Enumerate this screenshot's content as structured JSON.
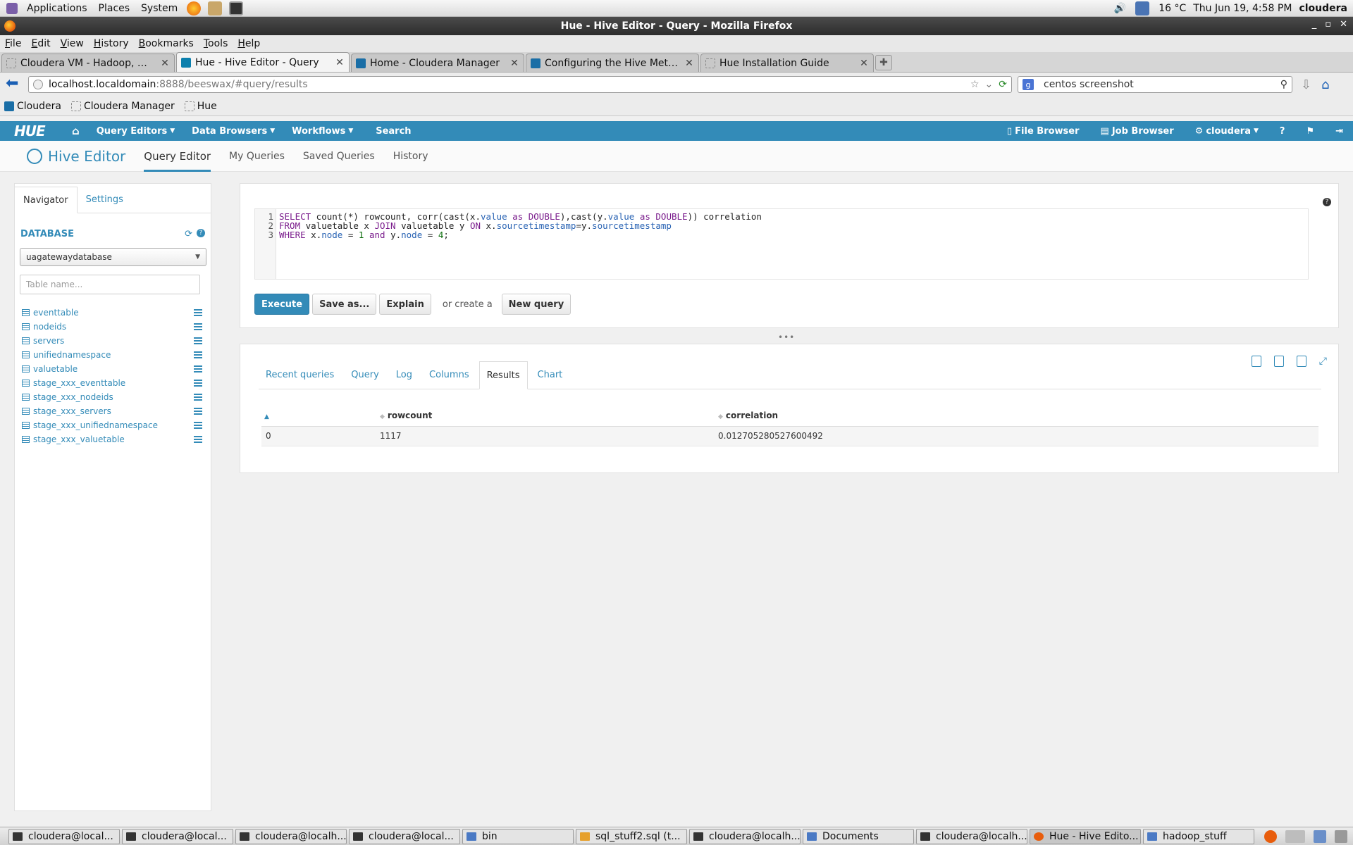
{
  "panel": {
    "menus": [
      "Applications",
      "Places",
      "System"
    ],
    "weather": "16 °C",
    "clock": "Thu Jun 19,  4:58 PM",
    "user": "cloudera"
  },
  "window": {
    "title": "Hue - Hive Editor - Query - Mozilla Firefox"
  },
  "menubar": [
    "File",
    "Edit",
    "View",
    "History",
    "Bookmarks",
    "Tools",
    "Help"
  ],
  "tabs": [
    {
      "title": "Cloudera VM - Hadoop, mad...",
      "active": false
    },
    {
      "title": "Hue - Hive Editor - Query",
      "active": true
    },
    {
      "title": "Home - Cloudera Manager",
      "active": false
    },
    {
      "title": "Configuring the Hive Metast...",
      "active": false
    },
    {
      "title": "Hue Installation Guide",
      "active": false
    }
  ],
  "url": {
    "host": "localhost.localdomain",
    "path": ":8888/beeswax/#query/results"
  },
  "search": {
    "value": "centos screenshot"
  },
  "bookmarks": [
    "Cloudera",
    "Cloudera Manager",
    "Hue"
  ],
  "hue_nav": {
    "logo": "HUE",
    "items": [
      "Query Editors",
      "Data Browsers",
      "Workflows",
      "Search"
    ],
    "right": [
      "File Browser",
      "Job Browser",
      "cloudera"
    ]
  },
  "subnav": {
    "brand": "Hive Editor",
    "items": [
      "Query Editor",
      "My Queries",
      "Saved Queries",
      "History"
    ]
  },
  "navigator": {
    "tabs": [
      "Navigator",
      "Settings"
    ],
    "db_label": "DATABASE",
    "db_selected": "uagatewaydatabase",
    "filter_placeholder": "Table name...",
    "tables": [
      "eventtable",
      "nodeids",
      "servers",
      "unifiednamespace",
      "valuetable",
      "stage_xxx_eventtable",
      "stage_xxx_nodeids",
      "stage_xxx_servers",
      "stage_xxx_unifiednamespace",
      "stage_xxx_valuetable"
    ]
  },
  "editor": {
    "line_numbers": [
      "1",
      "2",
      "3"
    ],
    "query_lines": [
      "SELECT count(*) rowcount, corr(cast(x.value as DOUBLE),cast(y.value as DOUBLE)) correlation",
      "FROM valuetable x JOIN valuetable y ON x.sourcetimestamp=y.sourcetimestamp",
      "WHERE x.node = 1 and y.node = 4;"
    ],
    "buttons": {
      "execute": "Execute",
      "save": "Save as...",
      "explain": "Explain",
      "or_create": "or create a",
      "new_query": "New query"
    }
  },
  "results": {
    "tabs": [
      "Recent queries",
      "Query",
      "Log",
      "Columns",
      "Results",
      "Chart"
    ],
    "active_tab": "Results",
    "columns": [
      "",
      "rowcount",
      "correlation"
    ],
    "rows": [
      [
        "0",
        "1117",
        "0.012705280527600492"
      ]
    ]
  },
  "taskbar": [
    {
      "label": "cloudera@local...",
      "icon": "terminal"
    },
    {
      "label": "cloudera@local...",
      "icon": "terminal"
    },
    {
      "label": "cloudera@localh...",
      "icon": "terminal"
    },
    {
      "label": "cloudera@local...",
      "icon": "terminal"
    },
    {
      "label": "bin",
      "icon": "folder"
    },
    {
      "label": "sql_stuff2.sql (t...",
      "icon": "document"
    },
    {
      "label": "cloudera@localh...",
      "icon": "terminal"
    },
    {
      "label": "Documents",
      "icon": "folder"
    },
    {
      "label": "cloudera@localh...",
      "icon": "terminal"
    },
    {
      "label": "Hue - Hive Edito...",
      "icon": "firefox"
    },
    {
      "label": "hadoop_stuff",
      "icon": "folder"
    }
  ],
  "colors": {
    "hue_blue": "#338bb8",
    "titlebar": "#2c2c2c"
  }
}
